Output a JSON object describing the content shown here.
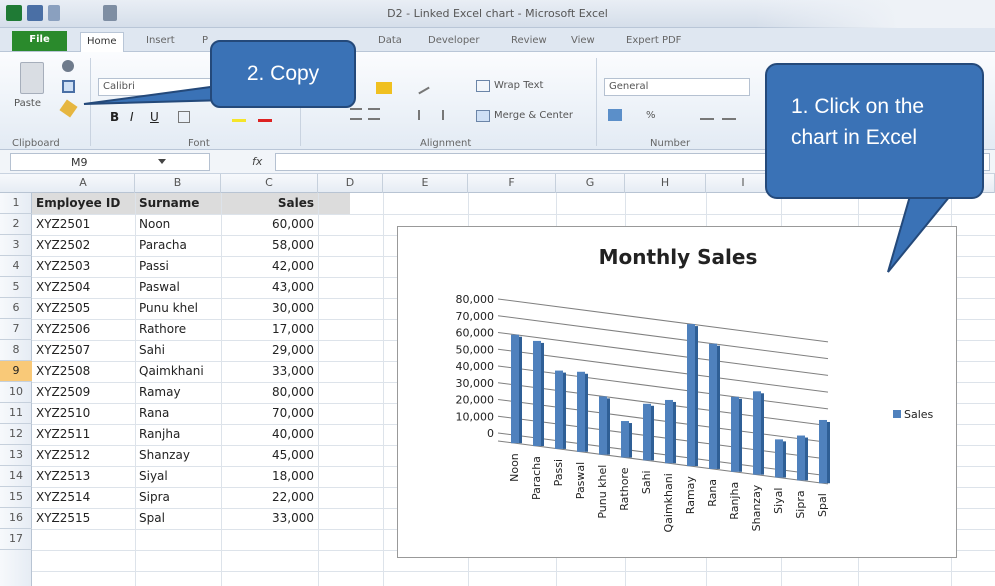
{
  "window": {
    "title": "D2 - Linked Excel chart - Microsoft Excel"
  },
  "tabs": [
    "File",
    "Home",
    "Insert",
    "P",
    "Data",
    "Developer",
    "Review",
    "View",
    "Expert PDF"
  ],
  "ribbon": {
    "clipboard": {
      "paste_label": "Paste",
      "group_label": "Clipboard"
    },
    "font": {
      "name": "Calibri",
      "group_label": "Font",
      "bold": "B",
      "italic": "I",
      "underline": "U"
    },
    "alignment": {
      "wrap_text": "Wrap Text",
      "merge_center": "Merge & Center",
      "group_label": "Alignment"
    },
    "number": {
      "format": "General",
      "percent": "%",
      "group_label": "Number"
    }
  },
  "formula_bar": {
    "name_box": "M9",
    "fx": "fx"
  },
  "grid": {
    "columns": [
      "A",
      "B",
      "C",
      "D",
      "E",
      "F",
      "G",
      "H",
      "I",
      "J",
      "K",
      "L"
    ],
    "rows": [
      "1",
      "2",
      "3",
      "4",
      "5",
      "6",
      "7",
      "8",
      "9",
      "10",
      "11",
      "12",
      "13",
      "14",
      "15",
      "16",
      "17"
    ],
    "active_row": "9",
    "header": [
      "Employee ID",
      "Surname",
      "Sales"
    ],
    "data": [
      [
        "XYZ2501",
        "Noon",
        "60,000"
      ],
      [
        "XYZ2502",
        "Paracha",
        "58,000"
      ],
      [
        "XYZ2503",
        "Passi",
        "42,000"
      ],
      [
        "XYZ2504",
        "Paswal",
        "43,000"
      ],
      [
        "XYZ2505",
        "Punu khel",
        "30,000"
      ],
      [
        "XYZ2506",
        "Rathore",
        "17,000"
      ],
      [
        "XYZ2507",
        "Sahi",
        "29,000"
      ],
      [
        "XYZ2508",
        "Qaimkhani",
        "33,000"
      ],
      [
        "XYZ2509",
        "Ramay",
        "80,000"
      ],
      [
        "XYZ2510",
        "Rana",
        "70,000"
      ],
      [
        "XYZ2511",
        "Ranjha",
        "40,000"
      ],
      [
        "XYZ2512",
        "Shanzay",
        "45,000"
      ],
      [
        "XYZ2513",
        "Siyal",
        "18,000"
      ],
      [
        "XYZ2514",
        "Sipra",
        "22,000"
      ],
      [
        "XYZ2515",
        "Spal",
        "33,000"
      ]
    ]
  },
  "callouts": {
    "copy": "2. Copy",
    "click": "1. Click on the chart in Excel"
  },
  "colors": {
    "bar": "#4f81bd",
    "callout": "#3a72b6",
    "file_tab": "#2a8a2c",
    "active_row": "#f9c978"
  },
  "chart_data": {
    "type": "bar",
    "title": "Monthly Sales",
    "categories": [
      "Noon",
      "Paracha",
      "Passi",
      "Paswal",
      "Punu khel",
      "Rathore",
      "Sahi",
      "Qaimkhani",
      "Ramay",
      "Rana",
      "Ranjha",
      "Shanzay",
      "Siyal",
      "Sipra",
      "Spal"
    ],
    "series": [
      {
        "name": "Sales",
        "values": [
          60000,
          58000,
          42000,
          43000,
          30000,
          17000,
          29000,
          33000,
          80000,
          70000,
          40000,
          45000,
          18000,
          22000,
          33000
        ]
      }
    ],
    "ylim": [
      0,
      80000
    ],
    "yticks": [
      "80,000",
      "70,000",
      "60,000",
      "50,000",
      "40,000",
      "30,000",
      "20,000",
      "10,000",
      "0"
    ],
    "grid": true,
    "legend": "right",
    "perspective": "3d"
  }
}
